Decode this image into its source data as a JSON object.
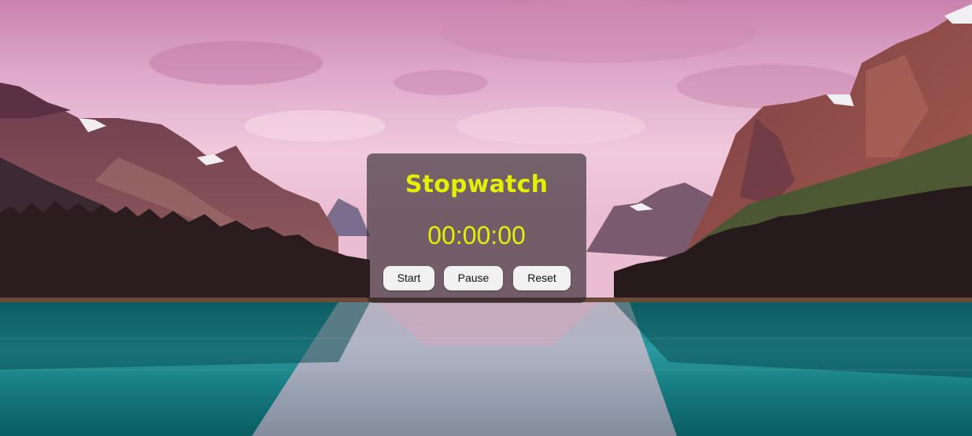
{
  "stopwatch": {
    "title": "Stopwatch",
    "time": "00:00:00",
    "start_label": "Start",
    "pause_label": "Pause",
    "reset_label": "Reset"
  },
  "colors": {
    "accent": "#e3f000",
    "button_bg": "#f1f1f1",
    "panel_bg": "#282226"
  }
}
